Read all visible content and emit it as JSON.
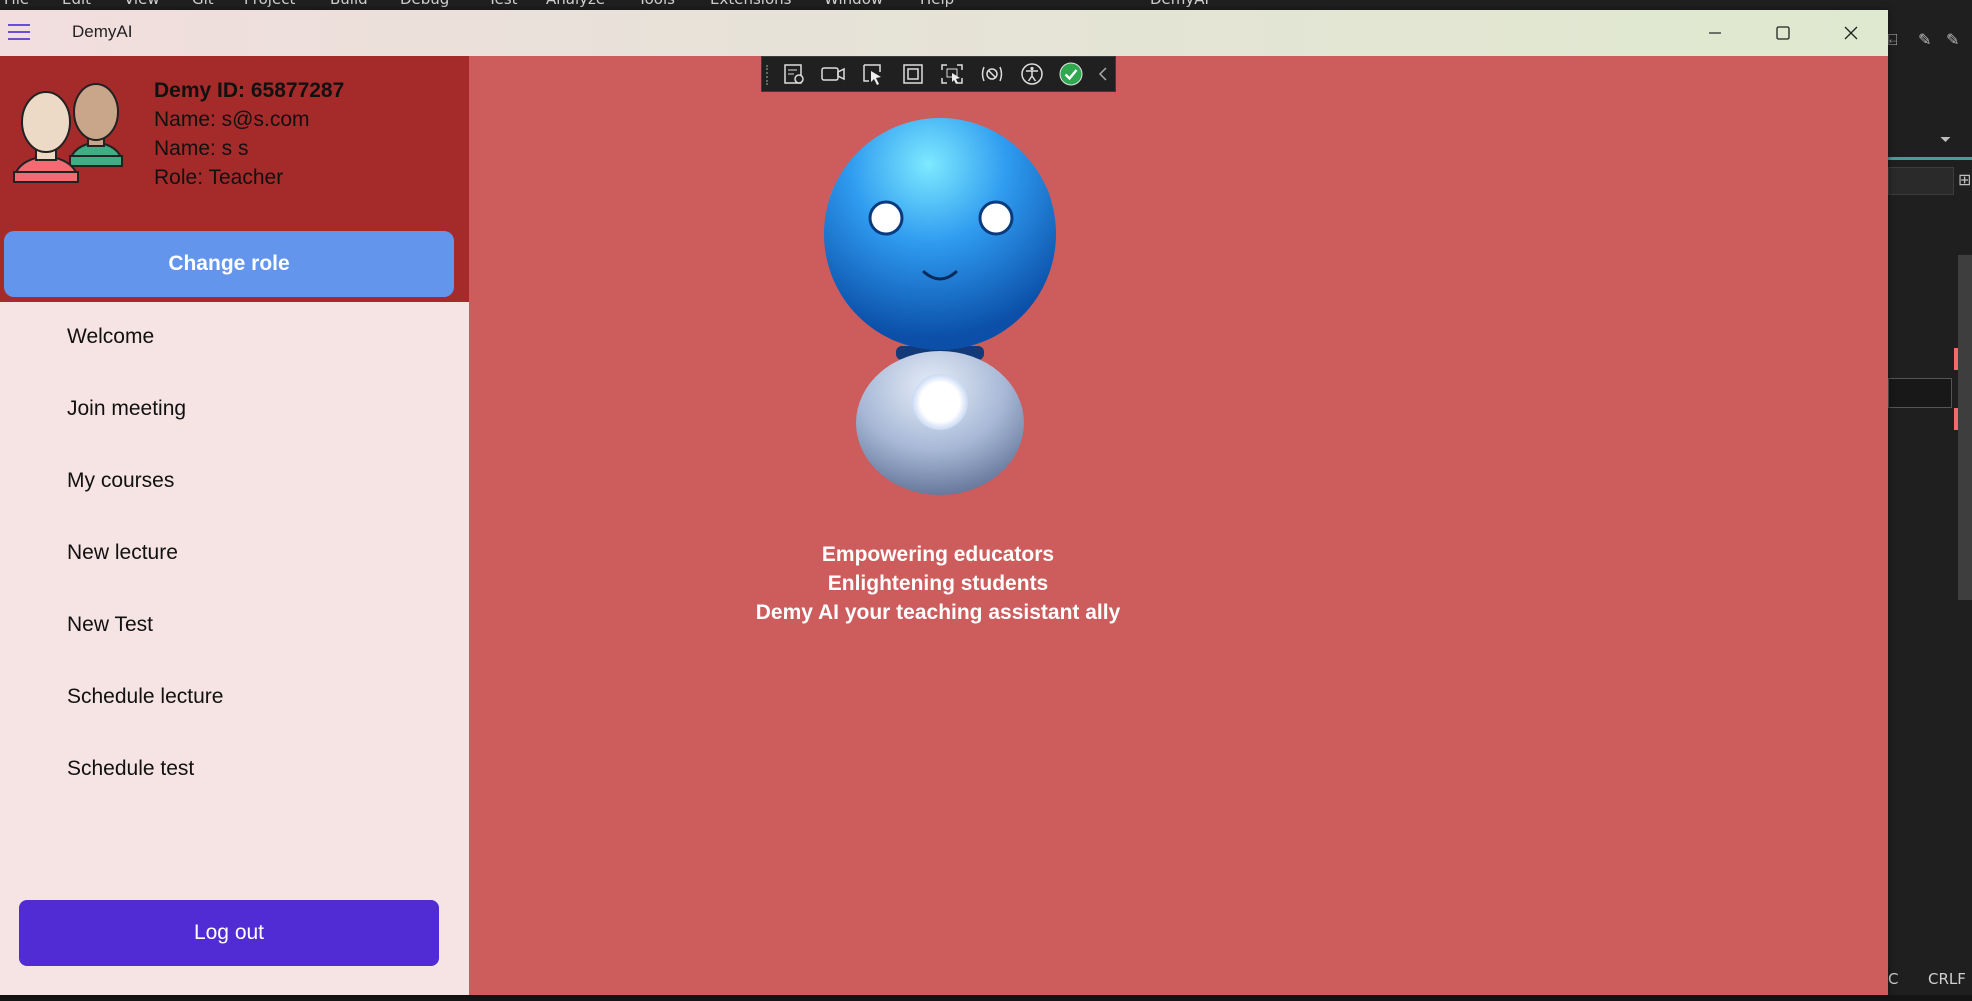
{
  "app": {
    "title": "DemyAI"
  },
  "user": {
    "demy_id": "Demy ID: 65877287",
    "email_line": "Name: s@s.com",
    "name_line": "Name: s s",
    "role_line": "Role: Teacher"
  },
  "drawer": {
    "change_role_label": "Change role",
    "menu": [
      {
        "label": "Welcome"
      },
      {
        "label": "Join meeting"
      },
      {
        "label": "My courses"
      },
      {
        "label": "New lecture"
      },
      {
        "label": "New Test"
      },
      {
        "label": "Schedule lecture"
      },
      {
        "label": "Schedule test"
      }
    ],
    "logout_label": "Log out"
  },
  "main": {
    "tagline": [
      "Empowering educators",
      "Enlightening students",
      "Demy AI your teaching assistant ally"
    ]
  },
  "debug_toolbar": {
    "icons": [
      "live-visual-tree-icon",
      "record-icon",
      "select-element-icon",
      "display-layout-adorners-icon",
      "track-focus-icon",
      "binding-failures-icon",
      "accessibility-checker-icon",
      "no-issues-check-icon",
      "collapse-toolbar-icon"
    ]
  },
  "status_bar": {
    "encoding_hint": "C",
    "line_endings": "CRLF"
  },
  "colors": {
    "content_bg": "#cd5c5c",
    "drawer_header_bg": "#a52a2a",
    "change_role_bg": "#6495ed",
    "logout_bg": "#512bd4",
    "drawer_bg": "#f6e3e3"
  }
}
